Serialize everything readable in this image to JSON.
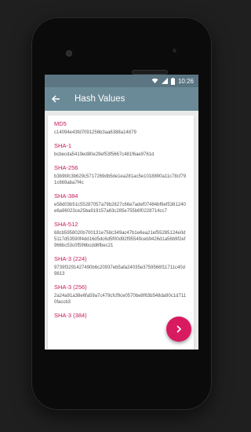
{
  "status_bar": {
    "time": "10:26",
    "icons": [
      "wifi-icon",
      "signal-icon",
      "battery-icon"
    ]
  },
  "app_bar": {
    "title": "Hash Values",
    "back_icon": "arrow-left-icon"
  },
  "hashes": [
    {
      "label": "MD5",
      "value": "c14094e43fd7091256b3aa6388a14879"
    },
    {
      "label": "SHA-1",
      "value": "bcbecda5419ed80e29ef53f5667c481f6ae9761d"
    },
    {
      "label": "SHA-256",
      "value": "b3b9bfc3b629c5717269db5de1ea281ac5e1018890a11c78cf791c669aba7f4c"
    },
    {
      "label": "SHA-384",
      "value": "e58d03b51c55287057a79b2827c66e7adef07484bf9ef5381240e6a96023ce25ba919157a63c285e755b6f0228714cc7"
    },
    {
      "label": "SHA-512",
      "value": "68cb5958020b700131e758c349ac47b1e6ea21ef55285124e0d5117d53590f4dd16d5dc6d5f00d92f95549ceb9426d1a56b9f2ef966bc53c0f596bcdd6fbec21"
    },
    {
      "label": "SHA-3 (224)",
      "value": "9739f3291427490b6c20937eb5afa24035e3759566f11711c40d9813"
    },
    {
      "label": "SHA-3 (256)",
      "value": "2a24a91a38e6fa59a7c479cfcf9ce0570be8f63b548da90c1d7110faccb3"
    },
    {
      "label": "SHA-3 (384)",
      "value": ""
    }
  ],
  "fab": {
    "icon": "chevron-right-icon"
  },
  "colors": {
    "accent": "#c2185b",
    "fab": "#d81b60",
    "app_bar": "#6a8a97",
    "status_bar": "#5b7582"
  }
}
